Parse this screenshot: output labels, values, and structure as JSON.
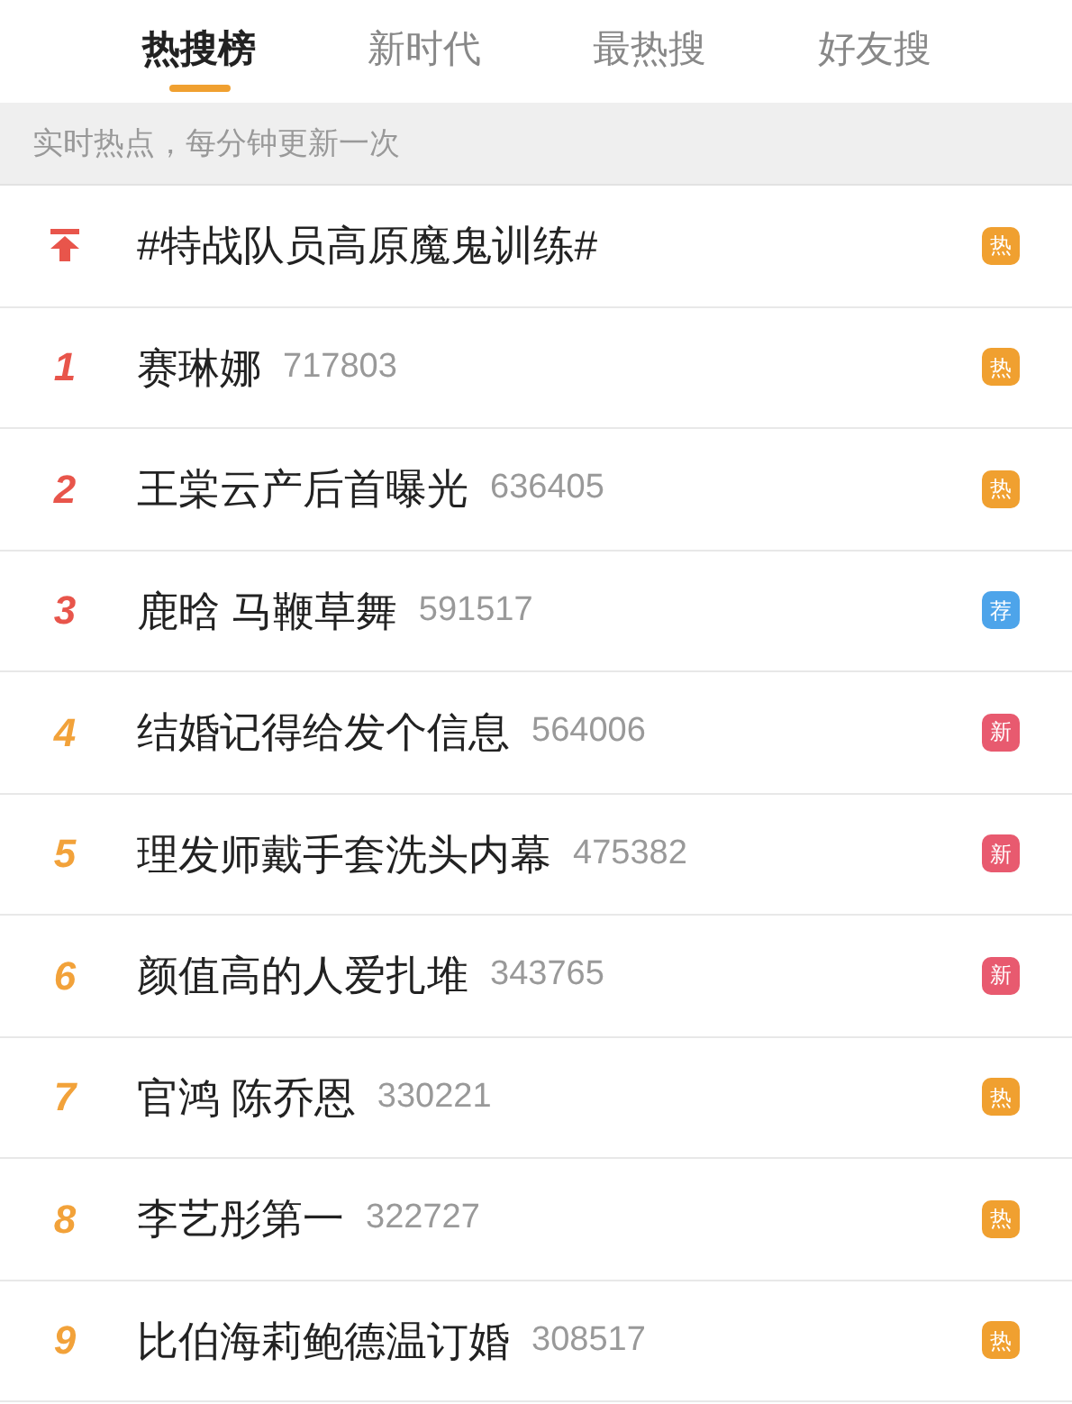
{
  "tabs": [
    {
      "label": "热搜榜",
      "selected": true
    },
    {
      "label": "新时代",
      "selected": false
    },
    {
      "label": "最热搜",
      "selected": false
    },
    {
      "label": "好友搜",
      "selected": false
    }
  ],
  "notice": "实时热点，每分钟更新一次",
  "items": [
    {
      "kind": "pinned",
      "title": "#特战队员高原魔鬼训练#",
      "badge": {
        "label": "热",
        "color": "#f0a030"
      }
    },
    {
      "kind": "ranked",
      "rank": "1",
      "top_three": true,
      "title": "赛琳娜",
      "count": "717803",
      "badge": {
        "label": "热",
        "color": "#f0a030"
      }
    },
    {
      "kind": "ranked",
      "rank": "2",
      "top_three": true,
      "title": "王棠云产后首曝光",
      "count": "636405",
      "badge": {
        "label": "热",
        "color": "#f0a030"
      }
    },
    {
      "kind": "ranked",
      "rank": "3",
      "top_three": true,
      "title": "鹿晗 马鞭草舞",
      "count": "591517",
      "badge": {
        "label": "荐",
        "color": "#4da4ea"
      }
    },
    {
      "kind": "ranked",
      "rank": "4",
      "top_three": false,
      "title": "结婚记得给发个信息",
      "count": "564006",
      "badge": {
        "label": "新",
        "color": "#e85a6f"
      }
    },
    {
      "kind": "ranked",
      "rank": "5",
      "top_three": false,
      "title": "理发师戴手套洗头内幕",
      "count": "475382",
      "badge": {
        "label": "新",
        "color": "#e85a6f"
      }
    },
    {
      "kind": "ranked",
      "rank": "6",
      "top_three": false,
      "title": "颜值高的人爱扎堆",
      "count": "343765",
      "badge": {
        "label": "新",
        "color": "#e85a6f"
      }
    },
    {
      "kind": "ranked",
      "rank": "7",
      "top_three": false,
      "title": "官鸿 陈乔恩",
      "count": "330221",
      "badge": {
        "label": "热",
        "color": "#f0a030"
      }
    },
    {
      "kind": "ranked",
      "rank": "8",
      "top_three": false,
      "title": "李艺彤第一",
      "count": "322727",
      "badge": {
        "label": "热",
        "color": "#f0a030"
      }
    },
    {
      "kind": "ranked",
      "rank": "9",
      "top_three": false,
      "title": "比伯海莉鲍德温订婚",
      "count": "308517",
      "badge": {
        "label": "热",
        "color": "#f0a030"
      }
    }
  ]
}
